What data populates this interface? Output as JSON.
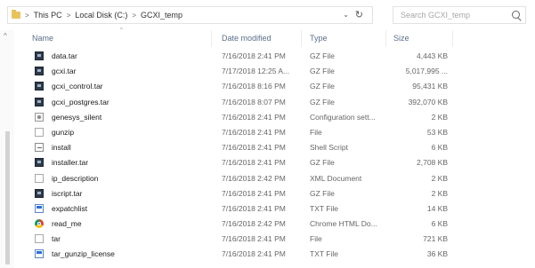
{
  "address_bar": {
    "crumbs": [
      "This PC",
      "Local Disk (C:)",
      "GCXI_temp"
    ],
    "separator": ">",
    "dropdown_glyph": "⌄",
    "refresh_glyph": "↻"
  },
  "search": {
    "placeholder": "Search GCXI_temp"
  },
  "nav": {
    "scroll_up_glyph": "^"
  },
  "columns": {
    "name": "Name",
    "date": "Date modified",
    "type": "Type",
    "size": "Size",
    "sort_glyph": "^"
  },
  "files": [
    {
      "name": "data.tar",
      "date": "7/16/2018 2:41 PM",
      "type": "GZ File",
      "size": "4,443 KB",
      "icon": "archive-icon"
    },
    {
      "name": "gcxi.tar",
      "date": "7/17/2018 12:25 A...",
      "type": "GZ File",
      "size": "5,017,995 ...",
      "icon": "archive-icon"
    },
    {
      "name": "gcxi_control.tar",
      "date": "7/16/2018 8:16 PM",
      "type": "GZ File",
      "size": "95,431 KB",
      "icon": "archive-icon"
    },
    {
      "name": "gcxi_postgres.tar",
      "date": "7/16/2018 8:07 PM",
      "type": "GZ File",
      "size": "392,070 KB",
      "icon": "archive-icon"
    },
    {
      "name": "genesys_silent",
      "date": "7/16/2018 2:41 PM",
      "type": "Configuration sett...",
      "size": "2 KB",
      "icon": "config-icon"
    },
    {
      "name": "gunzip",
      "date": "7/16/2018 2:41 PM",
      "type": "File",
      "size": "53 KB",
      "icon": "file-icon"
    },
    {
      "name": "install",
      "date": "7/16/2018 2:41 PM",
      "type": "Shell Script",
      "size": "6 KB",
      "icon": "script-icon"
    },
    {
      "name": "installer.tar",
      "date": "7/16/2018 2:41 PM",
      "type": "GZ File",
      "size": "2,708 KB",
      "icon": "archive-icon"
    },
    {
      "name": "ip_description",
      "date": "7/16/2018 2:42 PM",
      "type": "XML Document",
      "size": "2 KB",
      "icon": "xml-icon"
    },
    {
      "name": "iscript.tar",
      "date": "7/16/2018 2:41 PM",
      "type": "GZ File",
      "size": "2 KB",
      "icon": "archive-icon"
    },
    {
      "name": "expatchlist",
      "date": "7/16/2018 2:41 PM",
      "type": "TXT File",
      "size": "14 KB",
      "icon": "text-icon"
    },
    {
      "name": "read_me",
      "date": "7/16/2018 2:42 PM",
      "type": "Chrome HTML Do...",
      "size": "6 KB",
      "icon": "chrome-icon"
    },
    {
      "name": "tar",
      "date": "7/16/2018 2:41 PM",
      "type": "File",
      "size": "721 KB",
      "icon": "file-icon"
    },
    {
      "name": "tar_gunzip_license",
      "date": "7/16/2018 2:41 PM",
      "type": "TXT File",
      "size": "36 KB",
      "icon": "text-icon"
    }
  ]
}
